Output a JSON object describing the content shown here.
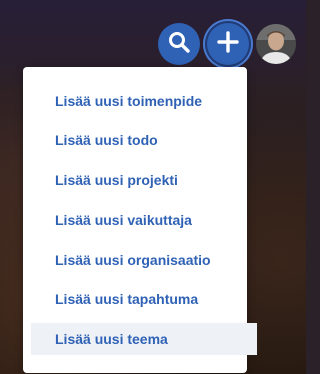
{
  "header": {
    "search_icon": "search-icon",
    "add_icon": "plus-icon",
    "avatar_icon": "user-avatar"
  },
  "colors": {
    "accent": "#2f62b5",
    "menu_background": "#ffffff",
    "active_item_background": "#eef1f6"
  },
  "menu": {
    "items": [
      {
        "label": "Lisää uusi toimenpide"
      },
      {
        "label": "Lisää uusi todo"
      },
      {
        "label": "Lisää uusi projekti"
      },
      {
        "label": "Lisää uusi vaikuttaja"
      },
      {
        "label": "Lisää uusi organisaatio"
      },
      {
        "label": "Lisää uusi tapahtuma"
      },
      {
        "label": "Lisää uusi teema"
      }
    ]
  }
}
